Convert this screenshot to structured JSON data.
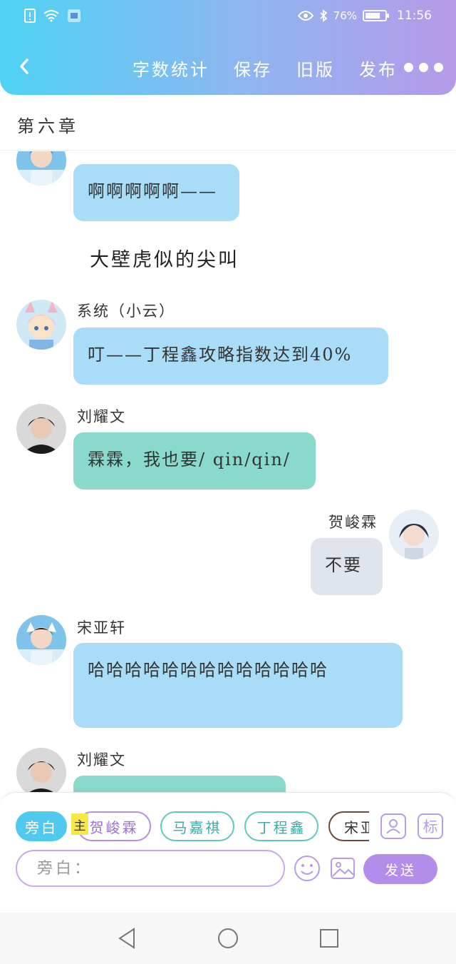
{
  "status_bar": {
    "battery_text": "76%",
    "battery_level": 0.76,
    "time": "11:56"
  },
  "header": {
    "back_icon": "chevron-left-icon",
    "actions": [
      "字数统计",
      "保存",
      "旧版",
      "发布"
    ],
    "more_icon": "more-dots-icon"
  },
  "chapter": {
    "title": "第六章"
  },
  "messages": [
    {
      "type": "left",
      "name": "",
      "text": "啊啊啊啊啊——",
      "color": "blue"
    },
    {
      "type": "narration",
      "text": "大壁虎似的尖叫"
    },
    {
      "type": "left",
      "name": "系统（小云）",
      "text": "叮——丁程鑫攻略指数达到40%",
      "color": "blue"
    },
    {
      "type": "left",
      "name": "刘耀文",
      "text": "霖霖，我也要/ qin/qin/",
      "color": "teal"
    },
    {
      "type": "right",
      "name": "贺峻霖",
      "text": "不要",
      "color": "gray"
    },
    {
      "type": "left",
      "name": "宋亚轩",
      "text": "哈哈哈哈哈哈哈哈哈哈哈哈哈",
      "color": "blue"
    },
    {
      "type": "left",
      "name": "刘耀文",
      "text": "",
      "color": "teal"
    }
  ],
  "composer": {
    "chips": [
      "旁白",
      "贺峻霖",
      "马嘉祺",
      "丁程鑫",
      "宋亚"
    ],
    "main_tag": "主",
    "tag_button": "标",
    "input_placeholder": "旁白：",
    "send_label": "发送"
  },
  "colors": {
    "header_start": "#4fd3f2",
    "header_end": "#b69ae8",
    "bubble_blue": "#a9dcf7",
    "bubble_teal": "#8ad9cd",
    "bubble_gray": "#dfe4ed",
    "accent_purple": "#b38de9"
  }
}
